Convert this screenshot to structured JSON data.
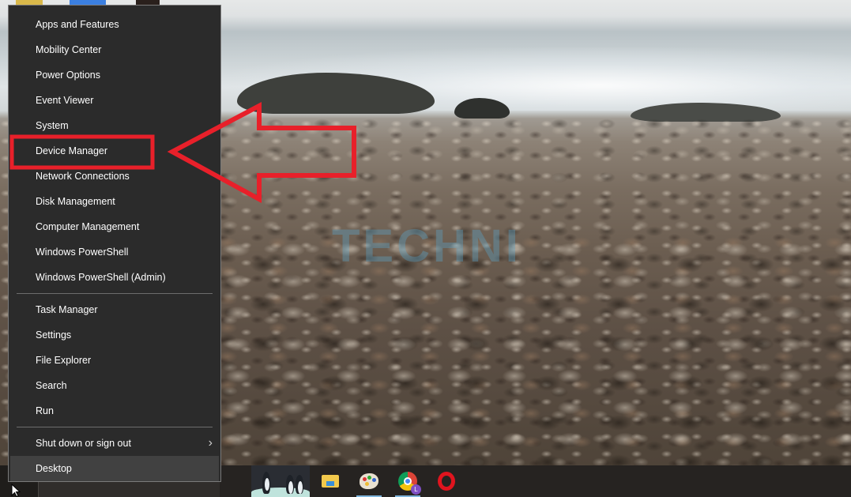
{
  "wallpaper": {
    "description": "Beach with crashing waves, rocks and pebbles",
    "watermark_text": "TECHNI"
  },
  "annotation": {
    "color": "#e8202a",
    "highlight_target": "Device Manager",
    "arrow_direction": "left"
  },
  "context_menu": {
    "groups": [
      {
        "items": [
          {
            "label": "Apps and Features"
          },
          {
            "label": "Mobility Center"
          },
          {
            "label": "Power Options"
          },
          {
            "label": "Event Viewer"
          },
          {
            "label": "System"
          },
          {
            "label": "Device Manager",
            "highlighted": true
          },
          {
            "label": "Network Connections"
          },
          {
            "label": "Disk Management"
          },
          {
            "label": "Computer Management"
          },
          {
            "label": "Windows PowerShell"
          },
          {
            "label": "Windows PowerShell (Admin)"
          }
        ]
      },
      {
        "items": [
          {
            "label": "Task Manager"
          },
          {
            "label": "Settings"
          },
          {
            "label": "File Explorer"
          },
          {
            "label": "Search"
          },
          {
            "label": "Run"
          }
        ]
      },
      {
        "items": [
          {
            "label": "Shut down or sign out",
            "submenu_icon": "chevron-right-icon",
            "submenu_glyph": "›"
          },
          {
            "label": "Desktop",
            "hovered": true
          }
        ]
      }
    ]
  },
  "taskbar": {
    "apps": [
      {
        "name": "File Explorer",
        "icon": "folder-icon",
        "running": false
      },
      {
        "name": "Paint",
        "icon": "paint-palette-icon",
        "running": true
      },
      {
        "name": "Google Chrome",
        "icon": "chrome-icon",
        "running": true,
        "profile_badge": "L"
      },
      {
        "name": "Opera",
        "icon": "opera-icon",
        "running": false
      }
    ]
  }
}
